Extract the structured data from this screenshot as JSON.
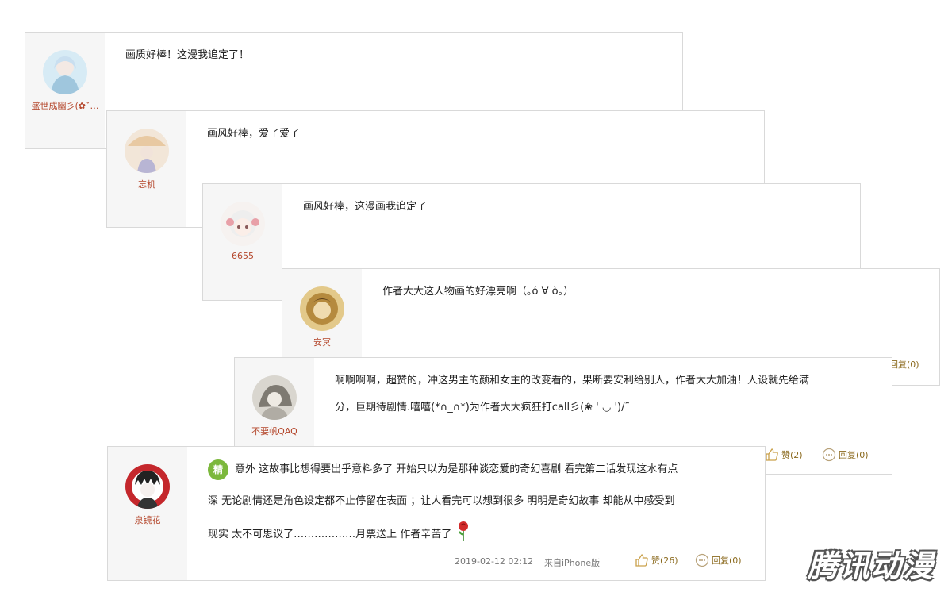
{
  "comments": [
    {
      "user": "盛世成幽彡(✿ˇ…",
      "text": "画质好棒！这漫我追定了！"
    },
    {
      "user": "忘机",
      "text": "画风好棒，爱了爱了"
    },
    {
      "user": "6655",
      "text": "画风好棒，这漫画我追定了"
    },
    {
      "user": "安冥",
      "text": "作者大大这人物画的好漂亮啊（｡ó ∀ ò｡）",
      "reply_label": "回复(0)"
    },
    {
      "user": "不要帆QAQ",
      "text_line1": "啊啊啊啊，超赞的，冲这男主的颜和女主的改变看的，果断要安利给别人，作者大大加油！人设就先给满",
      "text_line2": "分，巨期待剧情.嘻嘻(*∩_∩*)为作者大大疯狂打call彡(❀ ˈ ◡ ˈ)/˜",
      "like_label": "赞(2)",
      "reply_label": "回复(0)"
    },
    {
      "user": "泉镜花",
      "badge": "精",
      "text_line1": "意外  这故事比想得要出乎意料多了  开始只以为是那种谈恋爱的奇幻喜剧  看完第二话发现这水有点",
      "text_line2": "深  无论剧情还是角色设定都不止停留在表面 ；让人看完可以想到很多  明明是奇幻故事  却能从中感受到",
      "text_line3": "现实  太不可思议了………………月票送上  作者辛苦了",
      "timestamp": "2019-02-12 02:12",
      "source": "来自iPhone版",
      "like_label": "赞(26)",
      "reply_label": "回复(0)"
    }
  ],
  "watermark": "腾讯动漫",
  "colors": {
    "username": "#b4462b",
    "action": "#8b6a1e",
    "badge": "#7cb83c"
  }
}
